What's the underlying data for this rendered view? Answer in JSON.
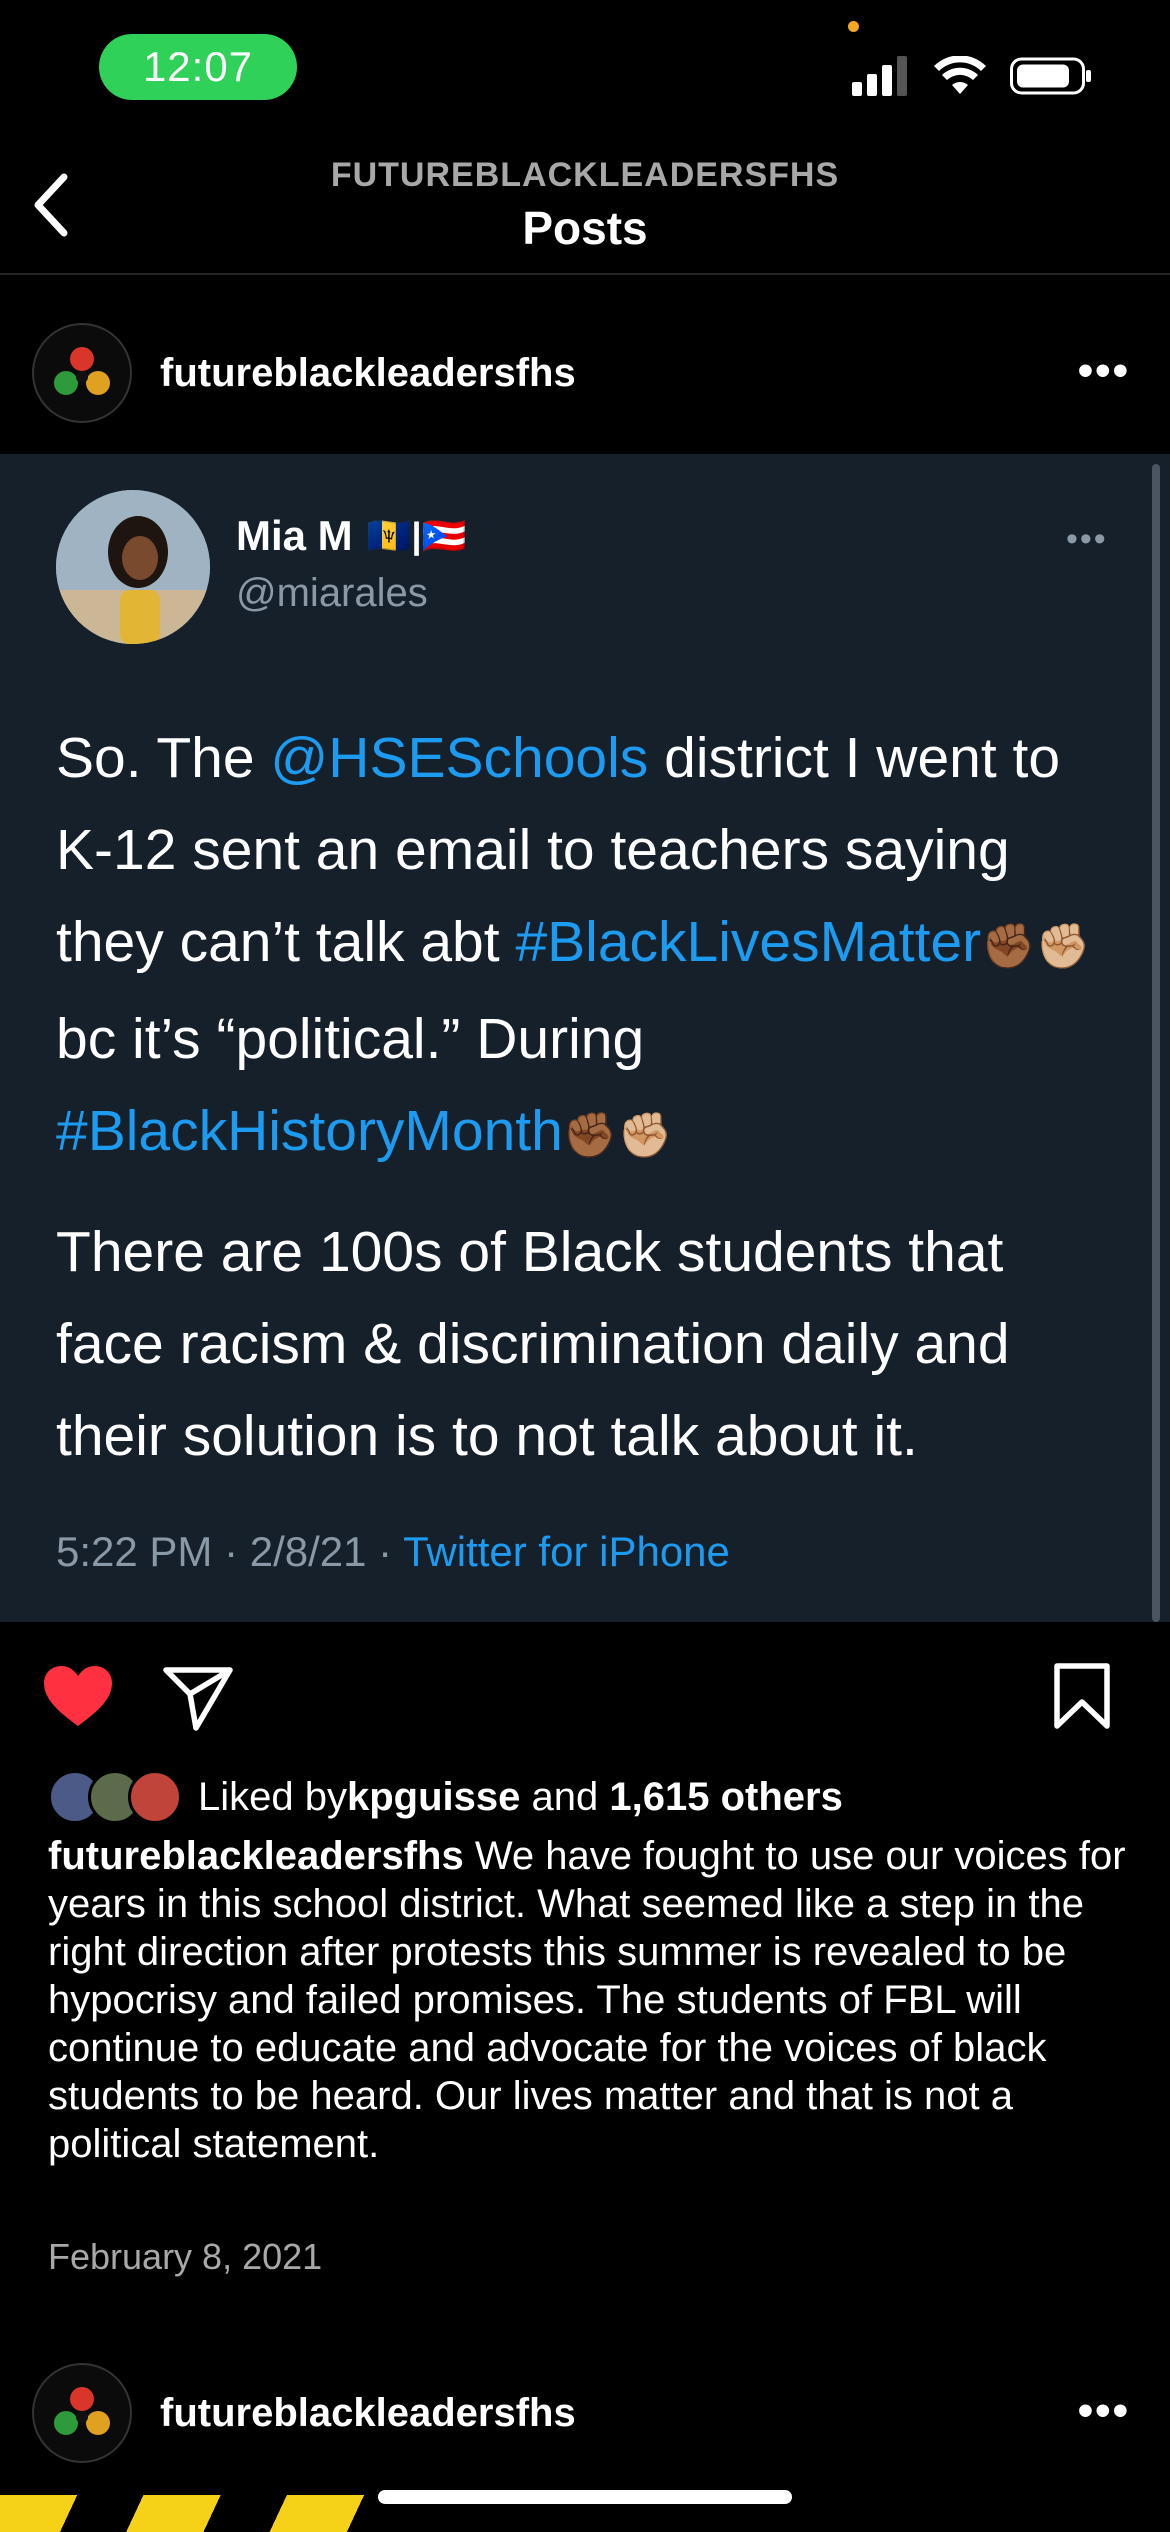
{
  "status_bar": {
    "time": "12:07"
  },
  "nav": {
    "account": "FUTUREBLACKLEADERSFHS",
    "title": "Posts"
  },
  "post": {
    "username": "futureblackleadersfhs",
    "tweet": {
      "name": "Mia M",
      "flags": "🇧🇧|🇵🇷",
      "handle": "@miarales",
      "p1_a": "So. The ",
      "p1_mention": "@HSESchools",
      "p1_b": " district I went to K-12 sent an email to teachers saying they can’t talk abt ",
      "p1_tag1": "#BlackLivesMatter",
      "p1_emoji1": "✊🏾✊🏼",
      "p1_c": " bc it’s “political.” During ",
      "p1_tag2": "#BlackHistoryMonth",
      "p1_emoji2": "✊🏾✊🏼",
      "p2": "There are 100s of Black students that face racism & discrimination daily and their solution is to not talk about it.",
      "meta_time": "5:22 PM · 2/8/21 · ",
      "meta_source": "Twitter for iPhone"
    },
    "likes": {
      "prefix": "Liked by ",
      "user": "kpguisse",
      "mid": " and ",
      "count": "1,615 others"
    },
    "caption_user": "futureblackleadersfhs",
    "caption_text": " We have fought to use our voices for years in this school district. What seemed like a step in the right direction after protests this summer is revealed to be hypocrisy and failed promises. The students of FBL will continue to educate and advocate for the voices of black students to be heard. Our lives matter and that is not a political statement.",
    "date": "February 8, 2021"
  },
  "next_post": {
    "username": "futureblackleadersfhs"
  },
  "colors": {
    "like_red": "#ff3040",
    "link_blue": "#1d9bf0",
    "tweet_bg": "#15202b",
    "time_pill": "#30d158"
  }
}
